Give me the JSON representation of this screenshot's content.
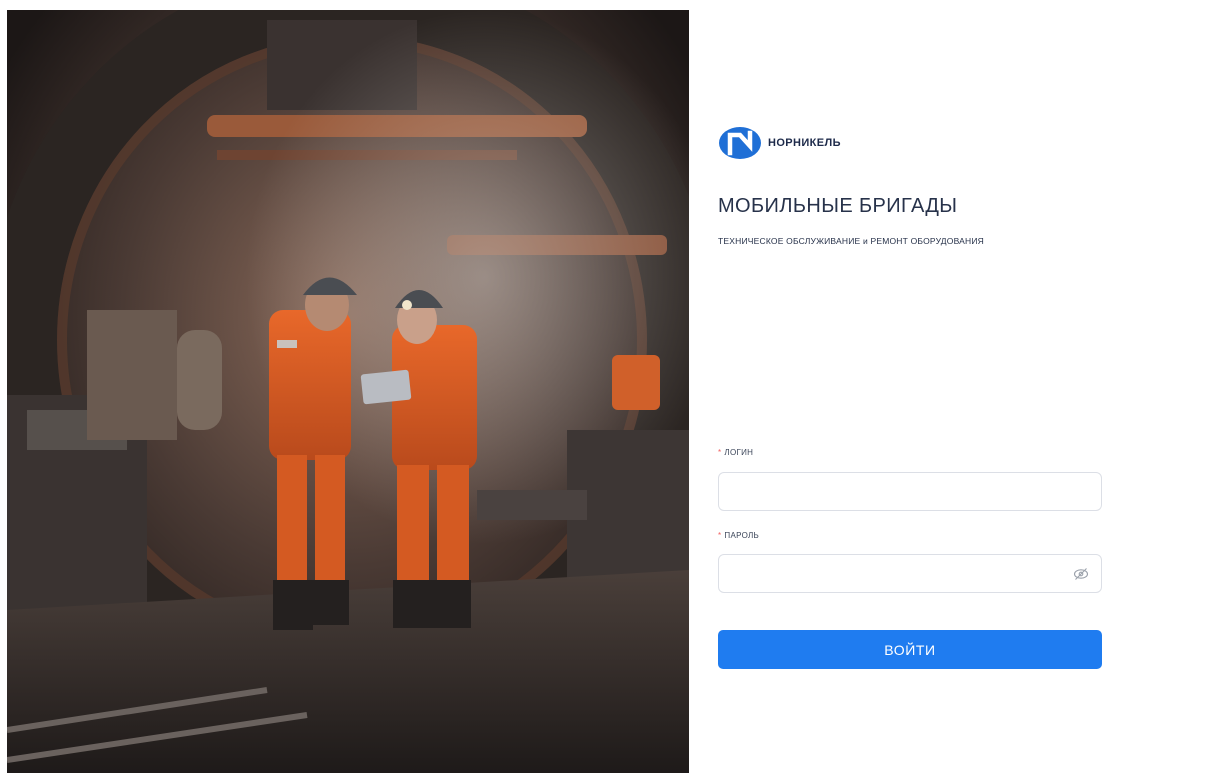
{
  "hero": {
    "image_subject": "two miners in orange workwear with helmets looking at a tablet in a mine tunnel"
  },
  "brand": {
    "logo_text": "НОРНИКЕЛЬ",
    "color": "#1f6fd6",
    "text_color": "#1d2a4a"
  },
  "app": {
    "title": "МОБИЛЬНЫЕ БРИГАДЫ",
    "subtitle": "ТЕХНИЧЕСКОЕ ОБСЛУЖИВАНИЕ и РЕМОНТ ОБОРУДОВАНИЯ"
  },
  "form": {
    "login": {
      "required_mark": "*",
      "label": "ЛОГИН",
      "value": "",
      "placeholder": ""
    },
    "password": {
      "required_mark": "*",
      "label": "ПАРОЛЬ",
      "value": "",
      "placeholder": "",
      "toggle_icon": "eye-slash-icon"
    },
    "submit_label": "ВОЙТИ"
  },
  "colors": {
    "accent": "#1f7cf0",
    "required": "#f26060",
    "border": "#dcdfe6"
  }
}
